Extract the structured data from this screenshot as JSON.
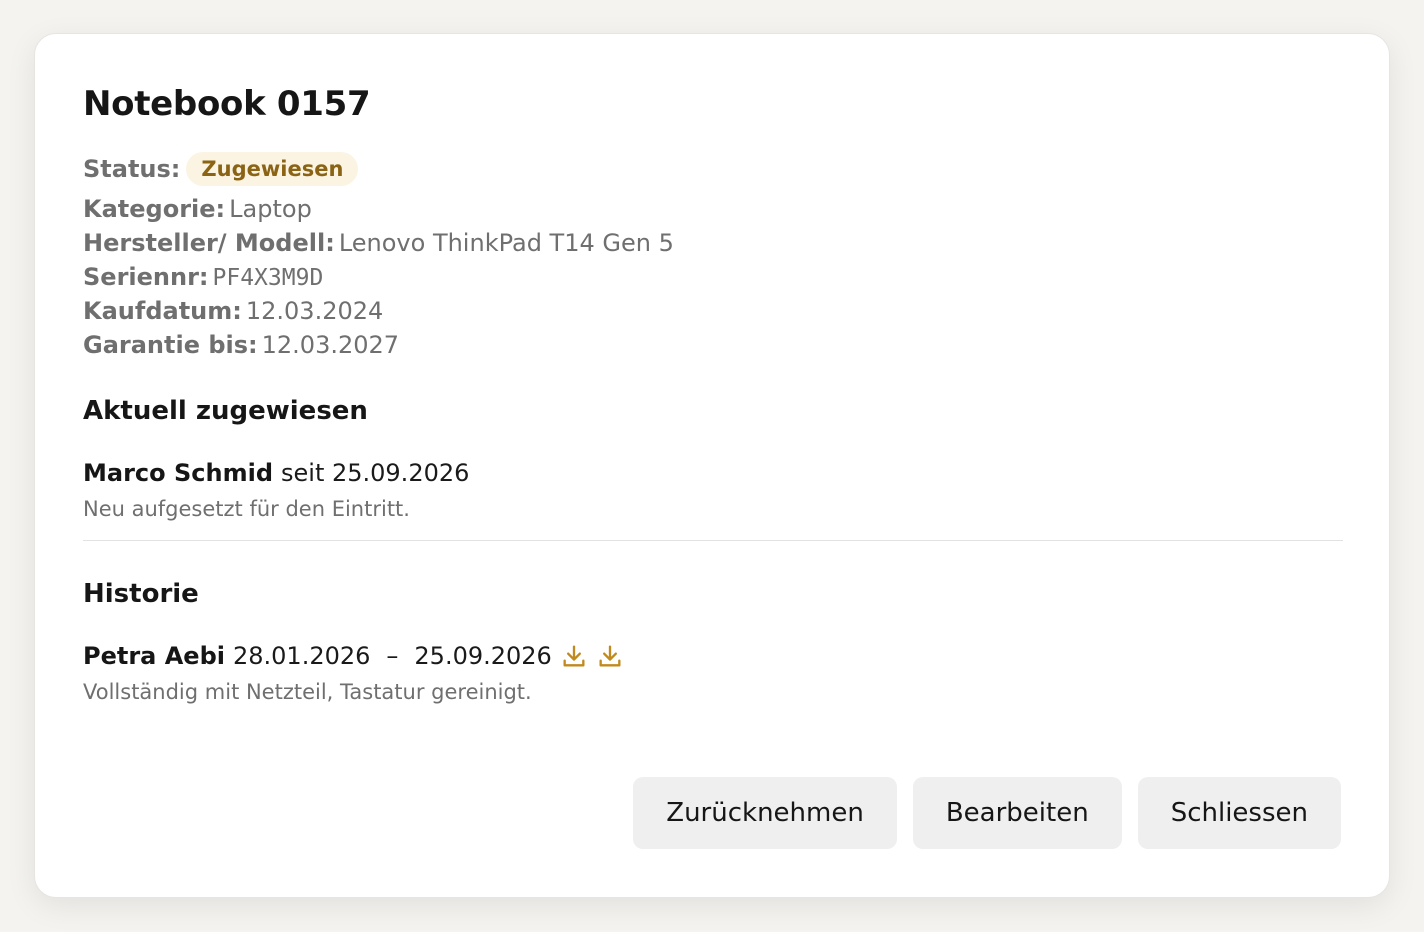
{
  "dialog": {
    "title": "Notebook 0157",
    "status": {
      "label": "Status:",
      "value": "Zugewiesen",
      "badge_bg": "#fbf4e3",
      "badge_color": "#8a6414"
    },
    "details": [
      {
        "label": "Kategorie:",
        "value": "Laptop"
      },
      {
        "label": "Hersteller/ Modell:",
        "value": "Lenovo ThinkPad T14 Gen 5"
      },
      {
        "label": "Seriennr:",
        "value": "PF4X3M9D"
      },
      {
        "label": "Kaufdatum:",
        "value": "12.03.2024"
      },
      {
        "label": "Garantie bis:",
        "value": "12.03.2027"
      }
    ],
    "current": {
      "title": "Aktuell zugewiesen",
      "person": "Marco Schmid",
      "since": "seit 25.09.2026",
      "note": "Neu aufgesetzt für den Eintritt."
    },
    "history": {
      "title": "Historie",
      "entries": [
        {
          "person": "Petra Aebi",
          "from": "28.01.2026",
          "separator": "–",
          "to": "25.09.2026",
          "icons": [
            "download-icon",
            "download-icon"
          ],
          "note": "Vollständig mit Netzteil, Tastatur gereinigt."
        }
      ]
    },
    "actions": {
      "revoke_label": "Zurücknehmen",
      "edit_label": "Bearbeiten",
      "close_label": "Schliessen"
    },
    "colors": {
      "accent": "#c08a1e",
      "muted_text": "#6f6f6f"
    }
  }
}
